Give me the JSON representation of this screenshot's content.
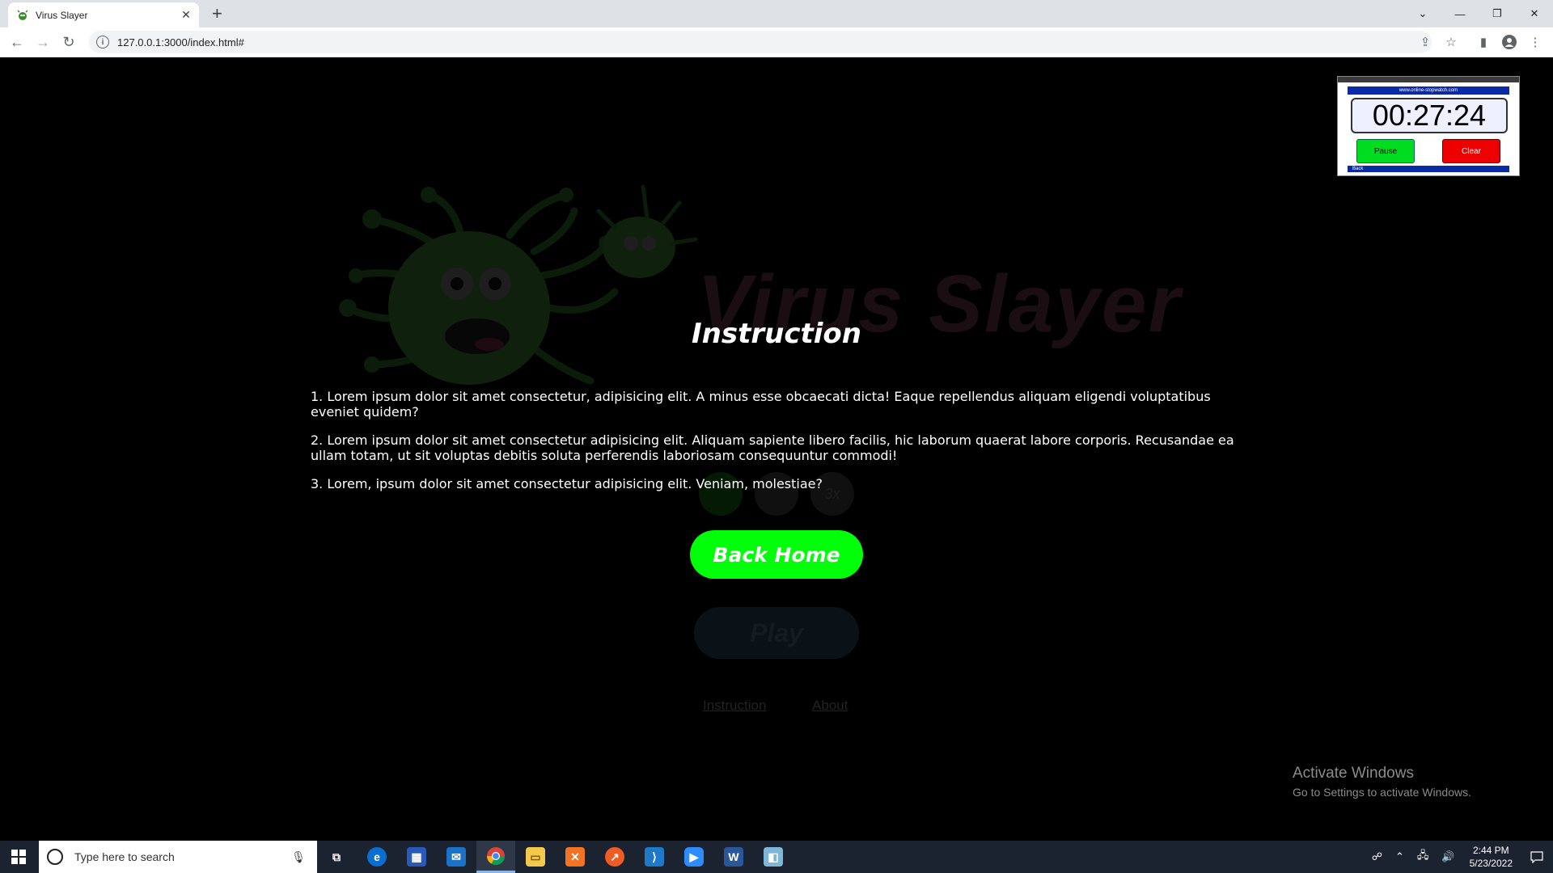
{
  "browser": {
    "tab_title": "Virus Slayer",
    "url": "127.0.0.1:3000/index.html#"
  },
  "page": {
    "background_title": "Virus Slayer",
    "speed_buttons": [
      "",
      "",
      "3x"
    ],
    "play_label": "Play",
    "links": [
      "Instruction",
      "About"
    ],
    "instruction": {
      "title": "Instruction",
      "items": [
        "1. Lorem ipsum dolor sit amet consectetur, adipisicing elit. A minus esse obcaecati dicta! Eaque repellendus aliquam eligendi voluptatibus eveniet quidem?",
        "2. Lorem ipsum dolor sit amet consectetur adipisicing elit. Aliquam sapiente libero facilis, hic laborum quaerat labore corporis. Recusandae ea ullam totam, ut sit voluptas debitis soluta perferendis laboriosam consequuntur commodi!",
        "3. Lorem, ipsum dolor sit amet consectetur adipisicing elit. Veniam, molestiae?"
      ],
      "back_label": "Back Home"
    },
    "colors": {
      "accent_green": "#00ff08",
      "background": "#000000"
    }
  },
  "stopwatch": {
    "url": "www.online-stopwatch.com",
    "time": "00:27:24",
    "pause_label": "Pause",
    "clear_label": "Clear",
    "back_label": "Back"
  },
  "watermark": {
    "line1": "Activate Windows",
    "line2": "Go to Settings to activate Windows."
  },
  "taskbar": {
    "search_placeholder": "Type here to search",
    "time": "2:44 PM",
    "date": "5/23/2022"
  }
}
